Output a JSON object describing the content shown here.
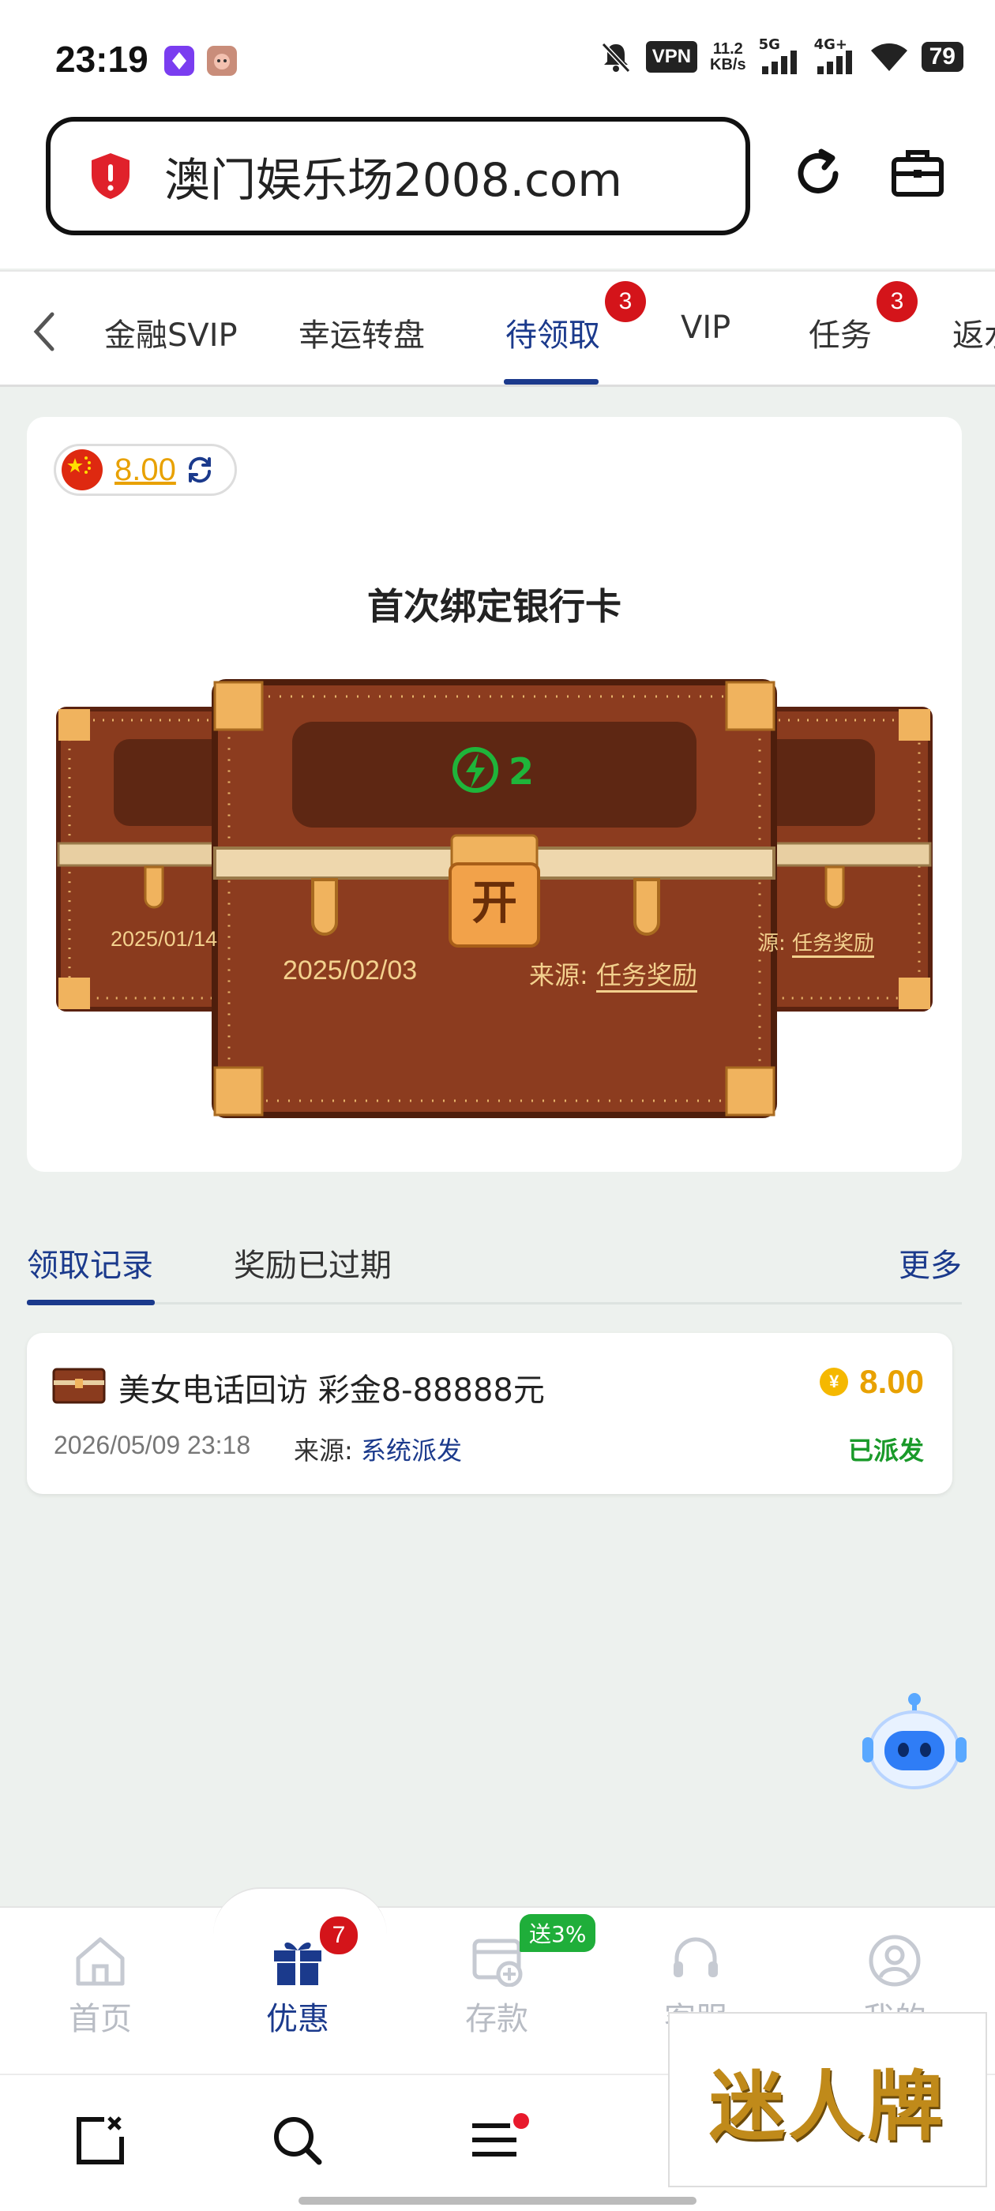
{
  "status_bar": {
    "time": "23:19",
    "vpn": "VPN",
    "speed_value": "11.2",
    "speed_unit": "KB/s",
    "net1": "5G",
    "net2": "4G+",
    "battery": "79"
  },
  "browser": {
    "url": "澳门娱乐场2008.com"
  },
  "tabs": [
    {
      "label": "金融SVIP",
      "badge": ""
    },
    {
      "label": "幸运转盘",
      "badge": ""
    },
    {
      "label": "待领取",
      "badge": "3"
    },
    {
      "label": "VIP",
      "badge": ""
    },
    {
      "label": "任务",
      "badge": "3"
    },
    {
      "label": "返水",
      "badge": ""
    }
  ],
  "balance": "8.00",
  "chest": {
    "title": "首次绑定银行卡",
    "energy": "2",
    "open_label": "开",
    "main_date": "2025/02/03",
    "source_label": "来源:",
    "source_value": "任务奖励",
    "left_date": "2025/01/14",
    "right_source_label": "源:",
    "right_source_value": "任务奖励"
  },
  "record_tabs": {
    "claimed": "领取记录",
    "expired": "奖励已过期",
    "more": "更多"
  },
  "record": {
    "title": "美女电话回访 彩金8-88888元",
    "amount": "8.00",
    "coin_symbol": "¥",
    "time": "2026/05/09 23:18",
    "source_label": "来源:",
    "source_value": "系统派发",
    "status": "已派发"
  },
  "bottom_nav": {
    "home": "首页",
    "promo": "优惠",
    "promo_badge": "7",
    "deposit": "存款",
    "deposit_badge": "送3%",
    "service": "客服",
    "mine": "我的"
  },
  "watermark": "迷人牌",
  "colors": {
    "accent": "#1b3a8c",
    "gold": "#e8a100",
    "badge_red": "#d4141a",
    "success_green": "#1a9a2a",
    "chest_brown": "#8a3b1e"
  }
}
